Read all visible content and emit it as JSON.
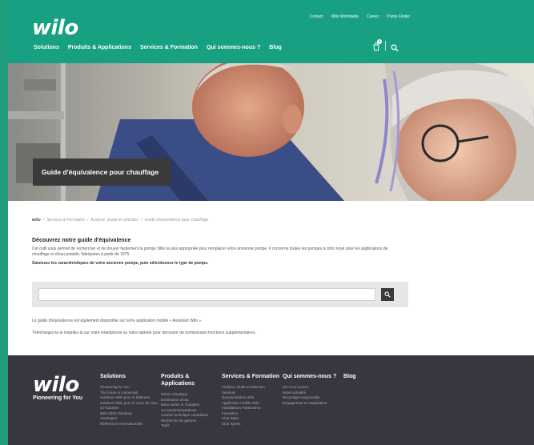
{
  "header": {
    "logo": "wilo",
    "top_links": [
      "Contact",
      "Wilo Worldwide",
      "Career",
      "Pump Finder"
    ],
    "nav": [
      "Solutions",
      "Produits & Applications",
      "Services & Formation",
      "Qui sommes-nous ?",
      "Blog"
    ],
    "cart_count": "0"
  },
  "hero": {
    "title": "Guide d'équivalence pour chauffage"
  },
  "breadcrumb": {
    "home": "wilo",
    "items": [
      "Services & Formation",
      "Analyse, étude et sélection",
      "Guide d'équivalence pour chauffage"
    ]
  },
  "content": {
    "title": "Découvrez notre guide d'équivalence",
    "description": "Cet outil vous permet de rechercher et de trouver facilement la pompe Wilo la plus appropriée pour remplacer votre ancienne pompe. Il concerne toutes les pompes à rotor noyé pour les applications de chauffage et d'eau potable, fabriquées à partir de 1975.",
    "instruction": "Saisissez les caractéristiques de votre ancienne pompe, puis sélectionnez le type de pompe.",
    "search_value": "",
    "note1": "Le guide d'équivalence est également disponible sur notre application mobile « Assistant Wilo ».",
    "note2": "Téléchargez-la et installez-la sur votre smartphone ou votre tablette pour découvrir de nombreuses fonctions supplémentaires."
  },
  "footer": {
    "logo": "wilo",
    "tagline": "Pioneering for You",
    "columns": [
      {
        "title": "Solutions",
        "items": [
          "Pioneering for You",
          "The future is connected",
          "Solutions Wilo pour le bâtiment",
          "Solutions Wilo pour le cycle de l'eau & l'industrie",
          "Wilo-OEM Solutions",
          "Avantages",
          "Références internationales"
        ]
      },
      {
        "title": "Produits & Applications",
        "items": [
          "Génie climatique",
          "Distribution d'eau",
          "Eaux usées et chargées",
          "Accessoires/systèmes",
          "Gestion technique centralisée",
          "Recherche de gamme",
          "Tarifs"
        ]
      },
      {
        "title": "Services & Formation",
        "items": [
          "Analyse, étude et sélection",
          "Services",
          "Documentation Wilo",
          "Application mobile Wilo",
          "Installateurs Partenaires",
          "Formation",
          "Club Delta",
          "Club Xperts"
        ]
      },
      {
        "title": "Qui sommes-nous ?",
        "items": [
          "Où nous trouver",
          "Notre actualité",
          "Recyclage responsable",
          "Engagement et coopération"
        ]
      },
      {
        "title": "Blog",
        "items": []
      }
    ]
  },
  "colors": {
    "brand_green": "#17a081",
    "dark": "#36373f"
  }
}
